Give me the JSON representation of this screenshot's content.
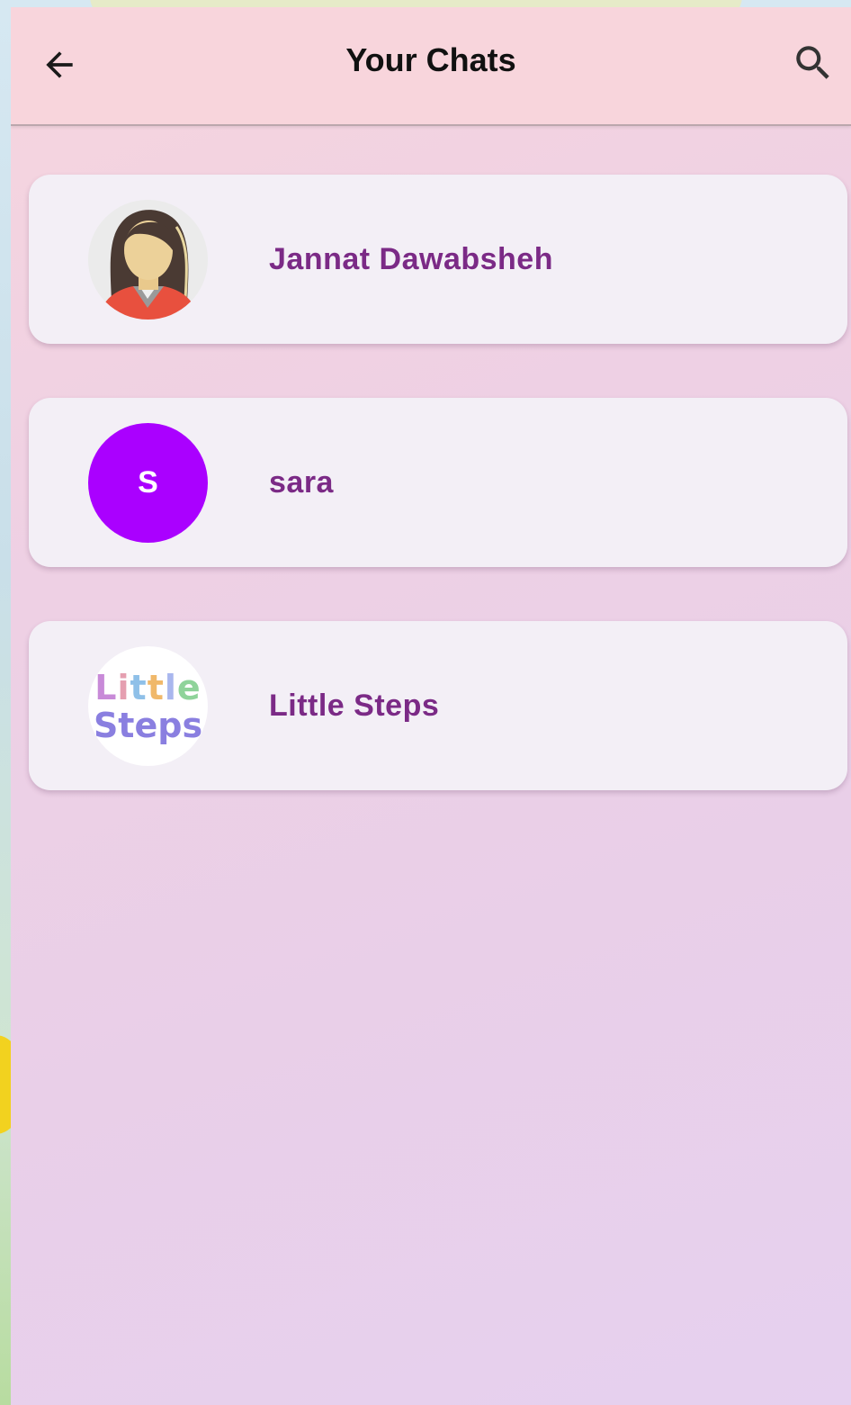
{
  "header": {
    "title": "Your Chats",
    "back_icon": "arrow-left-icon",
    "search_icon": "search-icon"
  },
  "chats": [
    {
      "name": "Jannat Dawabsheh",
      "avatar": "woman-avatar-icon"
    },
    {
      "name": "sara",
      "avatar_letter": "S",
      "avatar_color": "#aa00ff"
    },
    {
      "name": "Little Steps",
      "avatar": "little-steps-logo",
      "logo_line1": "Little",
      "logo_line2": "Steps"
    }
  ],
  "colors": {
    "appbar": "#f8d5dc",
    "card": "#f3eff6",
    "chat_name": "#7b2a86"
  }
}
